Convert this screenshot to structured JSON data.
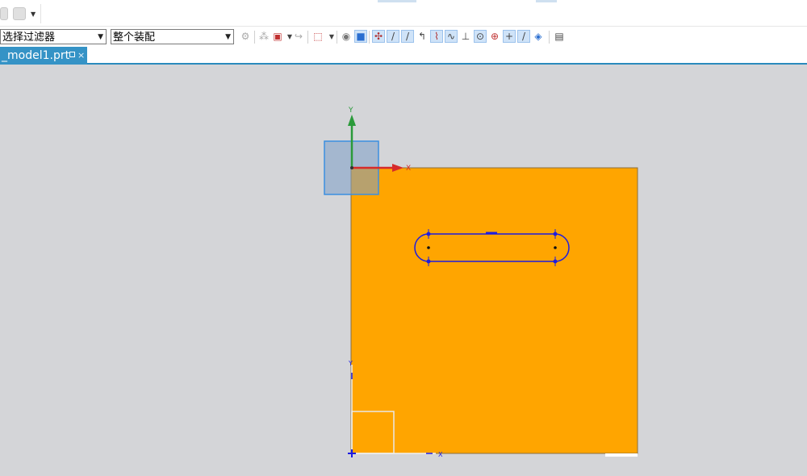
{
  "toolbar": {
    "selection_filter": "选择过滤器",
    "scope": "整个装配"
  },
  "tab": {
    "title": "_model1.prt",
    "close": "×"
  },
  "axes": {
    "x_label": "X",
    "y_label": "Y"
  },
  "colors": {
    "canvas_background": "#d4d5d8",
    "part_fill": "#ffa500",
    "sketch_curve": "#1d1de0",
    "tab_active": "#3593c6",
    "x_axis": "#d62b2b",
    "y_axis": "#2a9a3a",
    "view_cube": "#7b9fc8"
  }
}
